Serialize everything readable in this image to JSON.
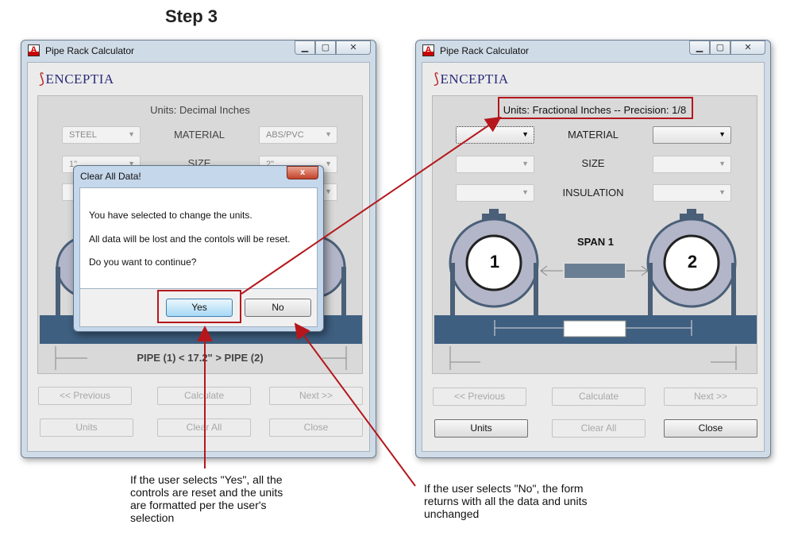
{
  "step_title": "Step 3",
  "logo_text": "ENCEPTIA",
  "left_window": {
    "title": "Pipe Rack Calculator",
    "units_text": "Units: Decimal Inches",
    "pipe1_material": "STEEL",
    "pipe2_material": "ABS/PVC",
    "pipe1_size": "1\"",
    "pipe2_size": "2\"",
    "material_label": "MATERIAL",
    "size_label": "SIZE",
    "dimension_text": "PIPE (1) <  17.2\"  > PIPE (2)",
    "buttons": {
      "previous": "<< Previous",
      "calculate": "Calculate",
      "next": "Next >>",
      "units": "Units",
      "clear_all": "Clear All",
      "close": "Close"
    }
  },
  "dialog": {
    "title": "Clear All Data!",
    "close_glyph": "x",
    "line1": "You have selected to change the units.",
    "line2": "All data will be lost and the contols will be reset.",
    "line3": "Do you want to continue?",
    "yes": "Yes",
    "no": "No"
  },
  "right_window": {
    "title": "Pipe Rack Calculator",
    "units_text": "Units: Fractional Inches -- Precision: 1/8",
    "material_label": "MATERIAL",
    "size_label": "SIZE",
    "insulation_label": "INSULATION",
    "span_label": "SPAN 1",
    "pipe1_number": "1",
    "pipe2_number": "2",
    "buttons": {
      "previous": "<< Previous",
      "calculate": "Calculate",
      "next": "Next >>",
      "units": "Units",
      "clear_all": "Clear All",
      "close": "Close"
    }
  },
  "annotations": {
    "yes_note": "If the user selects \"Yes\", all the controls are reset and the units are formatted per the user's selection",
    "no_note": "If the user selects \"No\", the form returns with all the data and units unchanged"
  },
  "colors": {
    "highlight": "#b5171c",
    "steel_beam": "#3e5f80",
    "pipe_outline": "#4a5f78",
    "pipe_fill": "#b3b5c8",
    "window_frame": "#cfdbe6",
    "dialog_frame": "#c5d7ea"
  },
  "icons": {
    "app": "app-icon",
    "minimize": "minimize-icon",
    "maximize": "maximize-icon",
    "close": "close-icon",
    "dropdown": "chevron-down-icon"
  }
}
